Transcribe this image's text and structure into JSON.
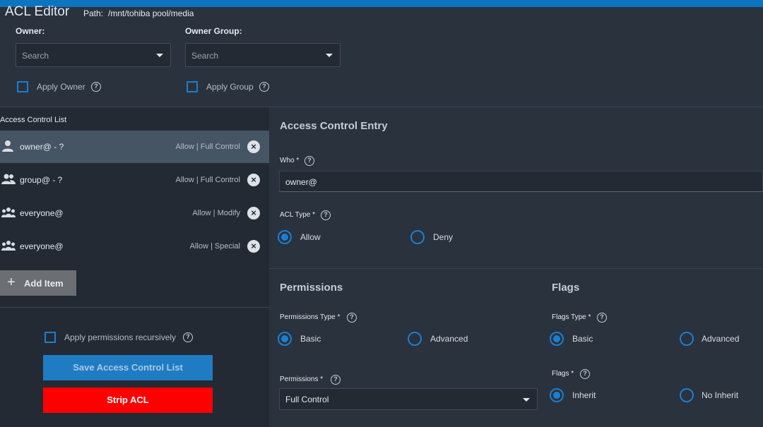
{
  "header": {
    "title": "ACL Editor",
    "path_label": "Path:",
    "path_value": "/mnt/tohiba pool/media"
  },
  "owner": {
    "label": "Owner:",
    "placeholder": "Search",
    "apply_label": "Apply Owner"
  },
  "owner_group": {
    "label": "Owner Group:",
    "placeholder": "Search",
    "apply_label": "Apply Group"
  },
  "acl_list": {
    "header": "Access Control List",
    "items": [
      {
        "who": "owner@ - ?",
        "perm": "Allow | Full Control",
        "icon": "user-icon"
      },
      {
        "who": "group@ - ?",
        "perm": "Allow | Full Control",
        "icon": "group-icon"
      },
      {
        "who": "everyone@",
        "perm": "Allow | Modify",
        "icon": "everyone-icon"
      },
      {
        "who": "everyone@",
        "perm": "Allow | Special",
        "icon": "everyone-icon"
      }
    ],
    "add_label": "Add Item",
    "recursive_label": "Apply permissions recursively",
    "save_label": "Save Access Control List",
    "strip_label": "Strip ACL"
  },
  "entry": {
    "title": "Access Control Entry",
    "who_label": "Who *",
    "who_value": "owner@",
    "acl_type_label": "ACL Type *",
    "acl_type_options": [
      "Allow",
      "Deny"
    ],
    "acl_type_selected": "Allow"
  },
  "permissions": {
    "title": "Permissions",
    "type_label": "Permissions Type *",
    "type_options": [
      "Basic",
      "Advanced"
    ],
    "perm_label": "Permissions *",
    "perm_value": "Full Control"
  },
  "flags": {
    "title": "Flags",
    "type_label": "Flags Type *",
    "type_options": [
      "Basic",
      "Advanced"
    ],
    "flags_label": "Flags *",
    "flags_options": [
      "Inherit",
      "No Inherit"
    ]
  },
  "colors": {
    "accent": "#1a7fd0",
    "strip": "#ff0000",
    "save": "#1f7cc3"
  }
}
